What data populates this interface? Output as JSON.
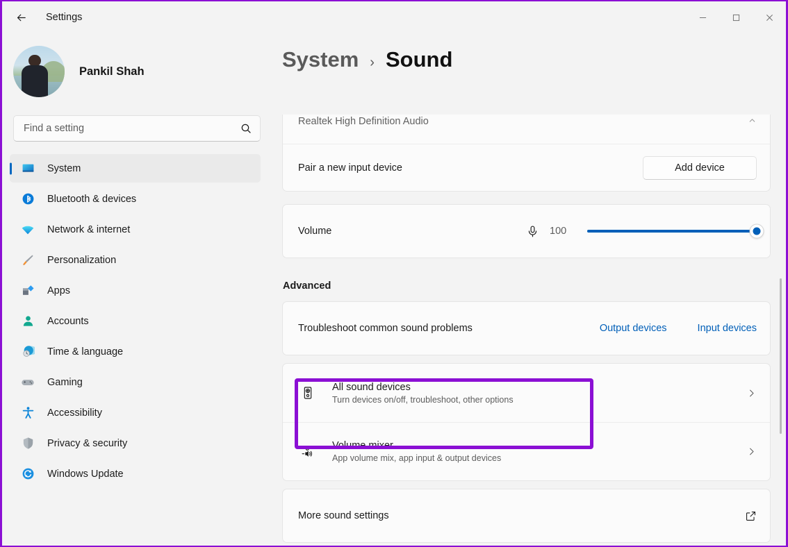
{
  "window": {
    "title": "Settings",
    "back_icon": "back-arrow-icon",
    "minimize_label": "—",
    "maximize_label": "□",
    "close_label": "✕"
  },
  "sidebar": {
    "profile": {
      "name": "Pankil Shah",
      "avatar_alt": "user-avatar"
    },
    "search": {
      "placeholder": "Find a setting",
      "value": "",
      "icon": "search-icon"
    },
    "items": [
      {
        "label": "System",
        "icon": "system-icon",
        "active": true
      },
      {
        "label": "Bluetooth & devices",
        "icon": "bluetooth-icon",
        "active": false
      },
      {
        "label": "Network & internet",
        "icon": "wifi-icon",
        "active": false
      },
      {
        "label": "Personalization",
        "icon": "paintbrush-icon",
        "active": false
      },
      {
        "label": "Apps",
        "icon": "apps-icon",
        "active": false
      },
      {
        "label": "Accounts",
        "icon": "accounts-icon",
        "active": false
      },
      {
        "label": "Time & language",
        "icon": "clock-globe-icon",
        "active": false
      },
      {
        "label": "Gaming",
        "icon": "gamepad-icon",
        "active": false
      },
      {
        "label": "Accessibility",
        "icon": "accessibility-icon",
        "active": false
      },
      {
        "label": "Privacy & security",
        "icon": "shield-icon",
        "active": false
      },
      {
        "label": "Windows Update",
        "icon": "update-icon",
        "active": false
      }
    ]
  },
  "main": {
    "breadcrumb": {
      "parent": "System",
      "separator": "›",
      "current": "Sound"
    },
    "top_card": {
      "device_name": "Realtek High Definition Audio",
      "pair_row": {
        "label": "Pair a new input device",
        "button": "Add device"
      }
    },
    "volume": {
      "label": "Volume",
      "icon": "microphone-icon",
      "value": "100",
      "percent": 100
    },
    "advanced": {
      "title": "Advanced",
      "troubleshoot": {
        "label": "Troubleshoot common sound problems",
        "links": [
          {
            "label": "Output devices"
          },
          {
            "label": "Input devices"
          }
        ]
      },
      "rows": [
        {
          "title": "All sound devices",
          "subtitle": "Turn devices on/off, troubleshoot, other options",
          "icon": "speaker-icon",
          "trailing_icon": "chevron-right-icon",
          "highlighted": true
        },
        {
          "title": "Volume mixer",
          "subtitle": "App volume mix, app input & output devices",
          "icon": "volume-mixer-icon",
          "trailing_icon": "chevron-right-icon",
          "highlighted": false
        }
      ],
      "more_sound_settings": {
        "label": "More sound settings",
        "trailing_icon": "external-link-icon"
      }
    }
  },
  "colors": {
    "accent": "#005fb8",
    "highlight": "#8b0fd4",
    "page_background": "#f3f3f3",
    "card_background": "#fbfbfb"
  }
}
